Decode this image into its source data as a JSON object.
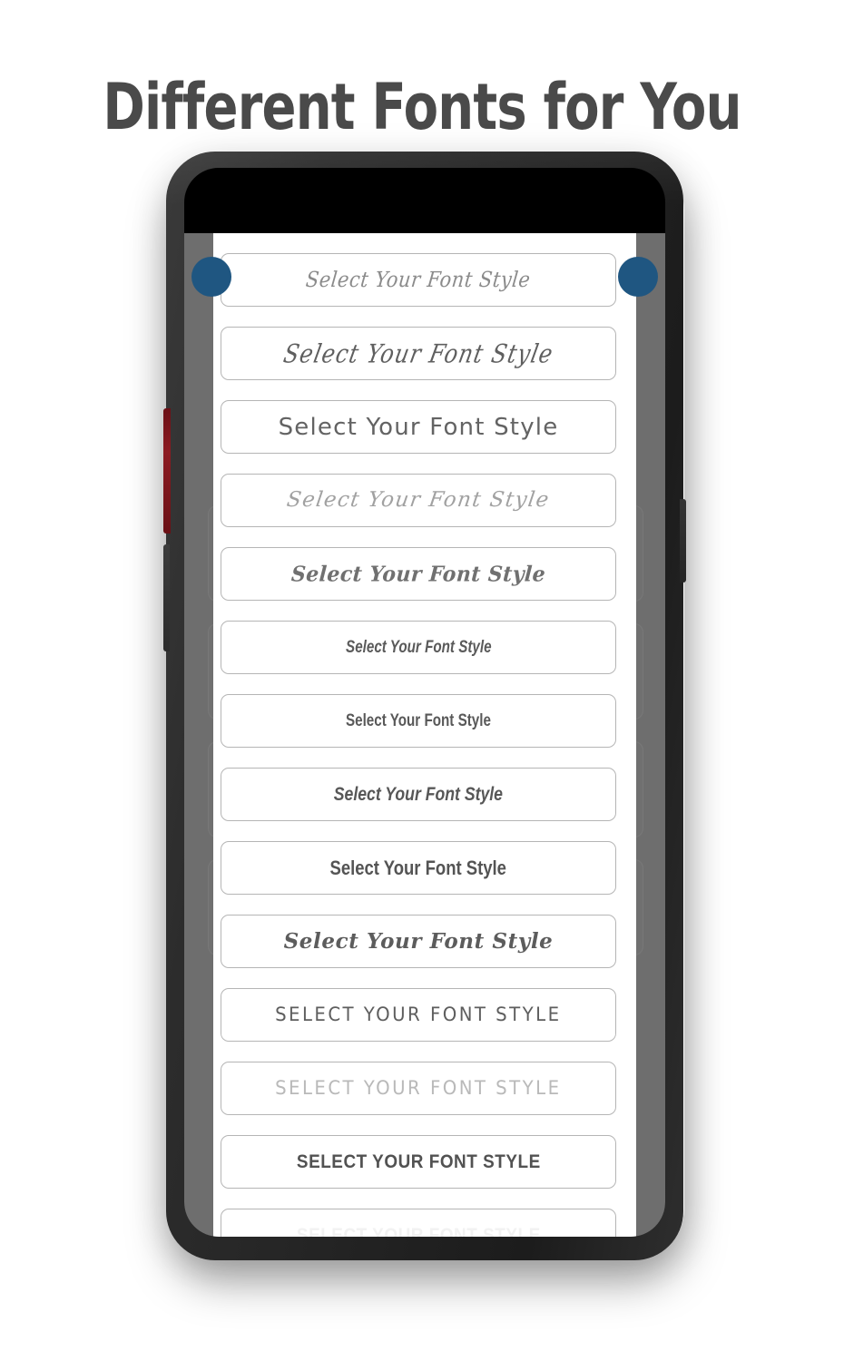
{
  "page": {
    "title": "Different Fonts for You",
    "background_color": "#ffffff",
    "title_color": "#4a4a4a"
  },
  "device": {
    "name": "smartphone-mockup",
    "frame_color": "#262626",
    "screen_background": "#000000",
    "app_background": "#6e6e6e",
    "sheet_background": "#ffffff",
    "accent_color": "#1f5681",
    "buttons": [
      {
        "name": "volume-button",
        "side": "left",
        "color": "#8d1b22"
      },
      {
        "name": "mute-button",
        "side": "left",
        "color": "#2b2b2b"
      },
      {
        "name": "power-button",
        "side": "right",
        "color": "#2f2f2f"
      }
    ]
  },
  "app": {
    "font_cards": [
      {
        "label": "Select Your Font Style",
        "style": "script-thin-italic",
        "color": "#8b8b8b"
      },
      {
        "label": "Select Your Font Style",
        "style": "calligraphy-script",
        "color": "#5f5f5f"
      },
      {
        "label": "Select Your Font Style",
        "style": "rounded-geometric-sans",
        "color": "#636363"
      },
      {
        "label": "Select Your Font Style",
        "style": "light-script",
        "color": "#a1a1a1"
      },
      {
        "label": "Select Your Font Style",
        "style": "casual-handwritten-script",
        "color": "#707070"
      },
      {
        "label": "Select Your Font Style",
        "style": "condensed-bold-italic",
        "color": "#5a5a5a"
      },
      {
        "label": "Select Your Font Style",
        "style": "condensed-bold",
        "color": "#595959"
      },
      {
        "label": "Select Your Font Style",
        "style": "slanted-bold-sans",
        "color": "#575757"
      },
      {
        "label": "Select Your Font Style",
        "style": "bold-condensed-sans",
        "color": "#545454"
      },
      {
        "label": "Select Your Font Style",
        "style": "bold-italic-serif-script",
        "color": "#5c5c5c"
      },
      {
        "label": "SELECT YOUR FONT STYLE",
        "style": "uppercase-condensed",
        "color": "#5e5e5e"
      },
      {
        "label": "SELECT YOUR FONT STYLE",
        "style": "uppercase-light-condensed",
        "color": "#b9b9b9"
      },
      {
        "label": "SELECT YOUR FONT STYLE",
        "style": "uppercase-bold-sans",
        "color": "#525252"
      },
      {
        "label": "SELECT YOUR FONT STYLE",
        "style": "uppercase-faded",
        "color": "#f2f2f2"
      }
    ]
  }
}
